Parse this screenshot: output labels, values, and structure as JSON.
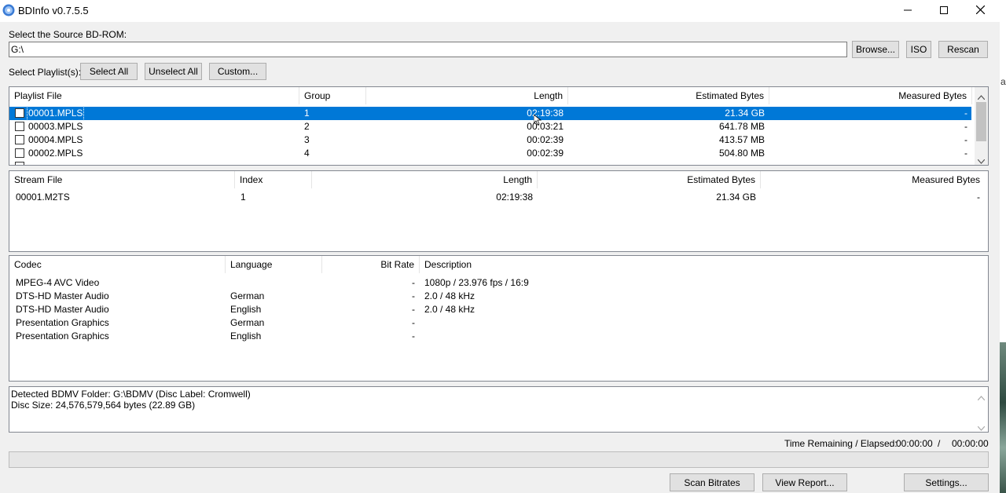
{
  "window": {
    "title": "BDInfo v0.7.5.5"
  },
  "source": {
    "label": "Select the Source BD-ROM:",
    "path": "G:\\",
    "browse": "Browse...",
    "iso": "ISO",
    "rescan": "Rescan"
  },
  "playlists": {
    "label": "Select Playlist(s):",
    "select_all": "Select All",
    "unselect_all": "Unselect All",
    "custom": "Custom...",
    "columns": [
      "Playlist File",
      "Group",
      "Length",
      "Estimated Bytes",
      "Measured Bytes"
    ],
    "rows": [
      {
        "file": "00001.MPLS",
        "group": "1",
        "length": "02:19:38",
        "estimated": "21.34 GB",
        "measured": "-"
      },
      {
        "file": "00003.MPLS",
        "group": "2",
        "length": "00:03:21",
        "estimated": "641.78 MB",
        "measured": "-"
      },
      {
        "file": "00004.MPLS",
        "group": "3",
        "length": "00:02:39",
        "estimated": "413.57 MB",
        "measured": "-"
      },
      {
        "file": "00002.MPLS",
        "group": "4",
        "length": "00:02:39",
        "estimated": "504.80 MB",
        "measured": "-"
      }
    ]
  },
  "streams": {
    "columns": [
      "Stream File",
      "Index",
      "Length",
      "Estimated Bytes",
      "Measured Bytes"
    ],
    "rows": [
      {
        "file": "00001.M2TS",
        "index": "1",
        "length": "02:19:38",
        "estimated": "21.34 GB",
        "measured": "-"
      }
    ]
  },
  "codecs": {
    "columns": [
      "Codec",
      "Language",
      "Bit Rate",
      "Description"
    ],
    "rows": [
      {
        "codec": "MPEG-4 AVC Video",
        "language": "",
        "bitrate": "-",
        "description": "1080p / 23.976 fps / 16:9"
      },
      {
        "codec": "DTS-HD Master Audio",
        "language": "German",
        "bitrate": "-",
        "description": "2.0 / 48 kHz"
      },
      {
        "codec": "DTS-HD Master Audio",
        "language": "English",
        "bitrate": "-",
        "description": "2.0 / 48 kHz"
      },
      {
        "codec": "Presentation Graphics",
        "language": "German",
        "bitrate": "-",
        "description": ""
      },
      {
        "codec": "Presentation Graphics",
        "language": "English",
        "bitrate": "-",
        "description": ""
      }
    ]
  },
  "log": {
    "lines": [
      "Detected BDMV Folder: G:\\BDMV (Disc Label: Cromwell)",
      "Disc Size: 24,576,579,564 bytes (22.89 GB)"
    ]
  },
  "status": {
    "time_label": "Time Remaining / Elapsed:",
    "remaining": "00:00:00",
    "separator": "/",
    "elapsed": "00:00:00",
    "progress": 0
  },
  "actions": {
    "scan_bitrates": "Scan Bitrates",
    "view_report": "View Report...",
    "settings": "Settings..."
  },
  "colors": {
    "selection": "#0078d7",
    "panel_border": "#828790",
    "background": "#f0f0f0"
  },
  "icons": [
    "bdinfo-disc-icon",
    "minimize-icon",
    "maximize-icon",
    "close-icon",
    "scroll-up-icon",
    "scroll-down-icon"
  ],
  "background_app": {
    "visible_char": "a"
  }
}
